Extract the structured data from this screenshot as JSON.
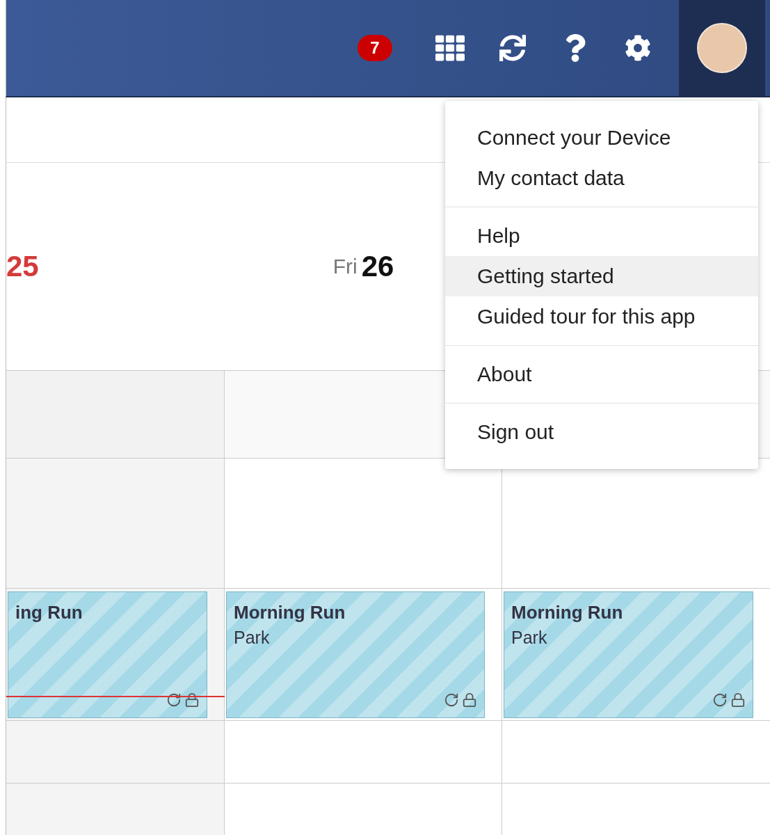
{
  "header": {
    "notification_count": "7",
    "avatar": {
      "kind": "photo"
    }
  },
  "days": [
    {
      "day": "25",
      "today": true
    },
    {
      "weekday": "Fri",
      "day": "26",
      "today": false
    }
  ],
  "events": [
    {
      "title": "ing Run",
      "recurring": true,
      "locked": true,
      "now_line": true
    },
    {
      "title": "Morning Run",
      "location": "Park",
      "recurring": true,
      "locked": true,
      "now_line": false
    },
    {
      "title": "Morning Run",
      "location": "Park",
      "recurring": true,
      "locked": true,
      "now_line": false
    }
  ],
  "user_menu": {
    "groups": [
      [
        {
          "label": "Connect your Device",
          "highlighted": false
        },
        {
          "label": "My contact data",
          "highlighted": false
        }
      ],
      [
        {
          "label": "Help",
          "highlighted": false
        },
        {
          "label": "Getting started",
          "highlighted": true
        },
        {
          "label": "Guided tour for this app",
          "highlighted": false
        }
      ],
      [
        {
          "label": "About",
          "highlighted": false
        }
      ],
      [
        {
          "label": "Sign out",
          "highlighted": false
        }
      ]
    ]
  }
}
